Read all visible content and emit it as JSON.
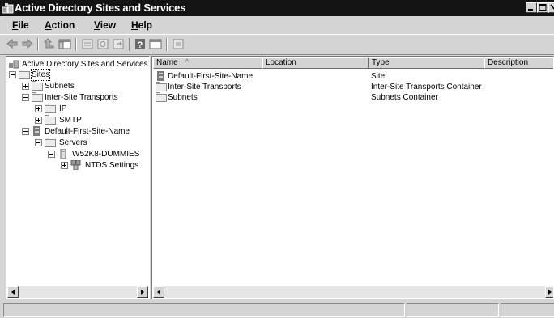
{
  "window": {
    "title": "Active Directory Sites and Services"
  },
  "menu": [
    {
      "label": "File",
      "key": "F",
      "rest": "ile"
    },
    {
      "label": "Action",
      "key": "A",
      "rest": "ction"
    },
    {
      "label": "View",
      "key": "V",
      "rest": "iew"
    },
    {
      "label": "Help",
      "key": "H",
      "rest": "elp"
    }
  ],
  "toolbar": {
    "icons": [
      "back-icon",
      "forward-icon",
      "up-level-icon",
      "show-hide-tree-icon",
      "properties-icon",
      "refresh-icon",
      "export-list-icon",
      "help-icon",
      "console-tree-icon",
      "new-site-icon"
    ]
  },
  "tree": {
    "root": "Active Directory Sites and Services",
    "sites": "Sites",
    "subnets": "Subnets",
    "inter_site_transports": "Inter-Site Transports",
    "ip": "IP",
    "smtp": "SMTP",
    "default_site": "Default-First-Site-Name",
    "servers": "Servers",
    "server": "W52K8-DUMMIES",
    "ntds": "NTDS Settings"
  },
  "list": {
    "columns": [
      "Name",
      "Location",
      "Type",
      "Description"
    ],
    "sort_indicator": "^",
    "rows": [
      {
        "name": "Default-First-Site-Name",
        "location": "",
        "type": "Site",
        "description": "",
        "icon": "site-icon"
      },
      {
        "name": "Inter-Site Transports",
        "location": "",
        "type": "Inter-Site Transports Container",
        "description": "",
        "icon": "folder-icon"
      },
      {
        "name": "Subnets",
        "location": "",
        "type": "Subnets Container",
        "description": "",
        "icon": "folder-icon"
      }
    ]
  },
  "colors": {
    "titlebar": "#141414",
    "chrome": "#d4d4d4",
    "pane": "#ffffff"
  }
}
